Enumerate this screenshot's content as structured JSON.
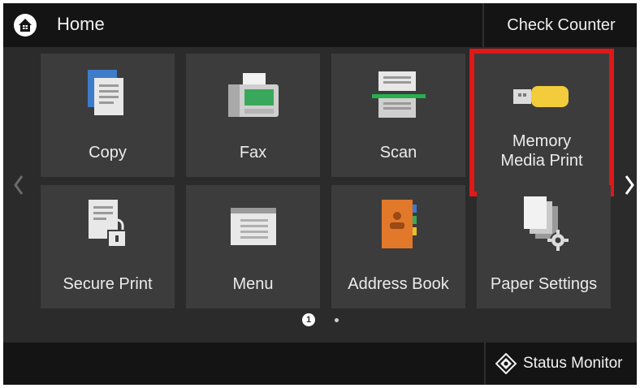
{
  "header": {
    "title": "Home",
    "check_counter_label": "Check Counter"
  },
  "tiles": [
    {
      "label": "Copy",
      "icon": "copy-icon"
    },
    {
      "label": "Fax",
      "icon": "fax-icon"
    },
    {
      "label": "Scan",
      "icon": "scan-icon"
    },
    {
      "label": "Memory\nMedia Print",
      "icon": "usb-memory-icon",
      "highlighted": true
    },
    {
      "label": "Secure Print",
      "icon": "secure-print-icon"
    },
    {
      "label": "Menu",
      "icon": "menu-icon"
    },
    {
      "label": "Address Book",
      "icon": "address-book-icon"
    },
    {
      "label": "Paper Settings",
      "icon": "paper-settings-icon"
    }
  ],
  "pagination": {
    "current_page": "1"
  },
  "footer": {
    "status_monitor_label": "Status Monitor"
  },
  "colors": {
    "highlight": "#e01818",
    "background": "#2b2b2b",
    "bar": "#141414",
    "tile": "#3c3c3c"
  }
}
